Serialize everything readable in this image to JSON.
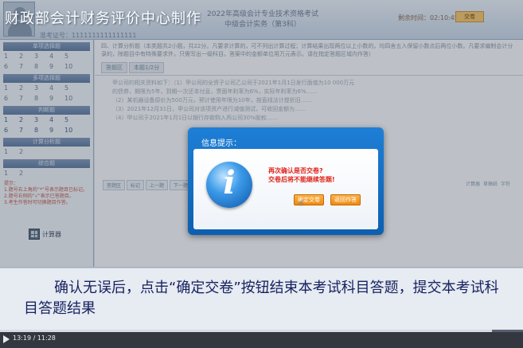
{
  "watermark": "财政部会计财务评价中心制作",
  "header": {
    "exam_title_line1": "2022年高级会计专业技术资格考试",
    "exam_title_line2": "中级会计实务（第3科）",
    "timer": "剩余时间：02:10:45",
    "button_label": "交卷",
    "ticket": "准考证号：1111111111111111"
  },
  "sidebar": {
    "sections": [
      {
        "title": "单项选择题",
        "rows": [
          [
            "1",
            "2",
            "3",
            "4",
            "5"
          ],
          [
            "6",
            "7",
            "8",
            "9",
            "10"
          ]
        ]
      },
      {
        "title": "多项选择题",
        "rows": [
          [
            "1",
            "2",
            "3",
            "4",
            "5"
          ],
          [
            "6",
            "7",
            "8",
            "9",
            "10"
          ]
        ]
      },
      {
        "title": "判断题",
        "rows": [
          [
            "1",
            "2",
            "3",
            "4",
            "5"
          ],
          [
            "6",
            "7",
            "8",
            "9",
            "10"
          ]
        ]
      },
      {
        "title": "计算分析题",
        "rows": [
          [
            "1",
            "2"
          ]
        ]
      },
      {
        "title": "综合题",
        "rows": [
          [
            "1",
            "2"
          ]
        ]
      }
    ],
    "notes": [
      "提示：",
      "1.题号右上角的“*”号表示题目已标记。",
      "2.题号右侧的“√”表示已答题目。",
      "3.考生作答时可切换题目作答。"
    ],
    "calculator_label": "计算器"
  },
  "main": {
    "question_text": "四、计算分析题（本类题共2小题，共22分。凡要求计算的，可不列出计算过程；计算结果出现两位以上小数的，均四舍五入保留小数点后两位小数。凡要求编制会计分录的，除题目中有特殊要求外，只需写出一级科目。答案中的金额单位用万元表示。请在指定答题区域内作答）",
    "tabs": [
      "答题区",
      "本题1/2分"
    ],
    "answer_lines": [
      "甲公司的相关资料如下：（1）甲公司的全资子公司乙公司于2021年1月1日发行面值为10 000万元",
      "的债券，期限为5年，到期一次还本付息，票面年利率为6%，实际年利率为6%……",
      "（2）某机器设备原价为500万元，预计使用年限为10年，按直线法计提折旧……",
      "（3）2021年12月31日，甲公司对该项资产进行减值测试，可收回金额为……",
      "（4）甲公司于2021年1月1日以银行存款购入丙公司30%股权……"
    ],
    "bottom_tabs": [
      "答题区",
      "标记",
      "上一题",
      "下一题"
    ],
    "tools": [
      "计算器",
      "草稿纸",
      "字符"
    ]
  },
  "dialog": {
    "title": "信息提示：",
    "message_line1": "再次确认是否交卷?",
    "message_line2": "交卷后将不能继续答题!",
    "confirm_label": "确定交卷",
    "back_label": "返回作答"
  },
  "caption": {
    "text": "确认无误后，点击“确定交卷”按钮结束本考试科目答题，提交本考试科目答题结果"
  },
  "video": {
    "time": "13:19 / 11:28",
    "progress": 0.94
  }
}
